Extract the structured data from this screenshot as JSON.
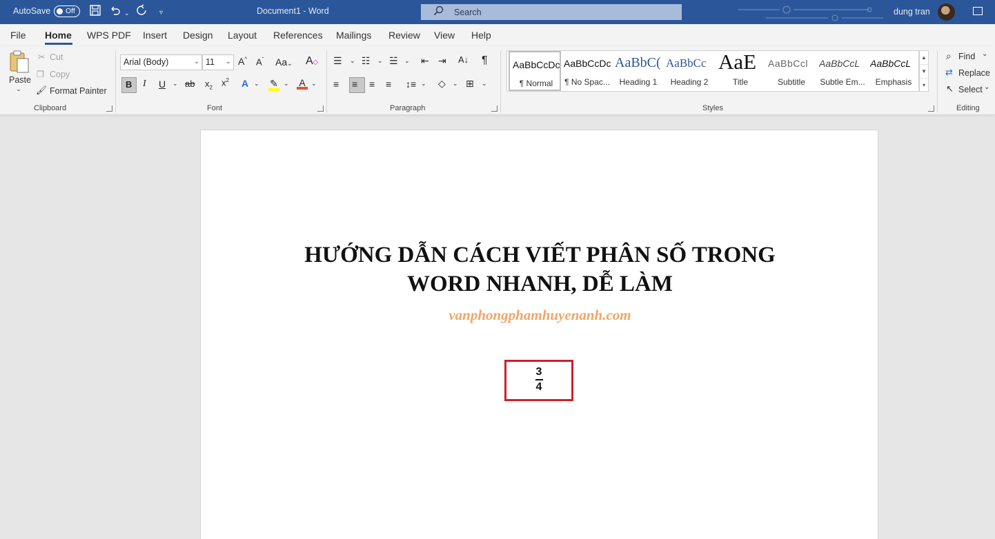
{
  "titlebar": {
    "autosave_label": "AutoSave",
    "autosave_state": "Off",
    "doc_title": "Document1  -  Word",
    "search_placeholder": "Search",
    "user_name": "dung tran",
    "bg_color": "#2b579a"
  },
  "tabs": [
    "File",
    "Home",
    "WPS PDF",
    "Insert",
    "Design",
    "Layout",
    "References",
    "Mailings",
    "Review",
    "View",
    "Help"
  ],
  "active_tab": "Home",
  "clipboard": {
    "paste": "Paste",
    "cut": "Cut",
    "copy": "Copy",
    "format_painter": "Format Painter",
    "label": "Clipboard"
  },
  "font": {
    "family": "Arial (Body)",
    "size": "11",
    "case": "Aa",
    "label": "Font"
  },
  "paragraph": {
    "label": "Paragraph"
  },
  "styles": {
    "label": "Styles",
    "items": [
      {
        "preview": "AaBbCcDc",
        "name": "¶ Normal"
      },
      {
        "preview": "AaBbCcDc",
        "name": "¶ No Spac..."
      },
      {
        "preview": "AaBbC(",
        "name": "Heading 1"
      },
      {
        "preview": "AaBbCc",
        "name": "Heading 2"
      },
      {
        "preview": "AaE",
        "name": "Title"
      },
      {
        "preview": "AaBbCcl",
        "name": "Subtitle"
      },
      {
        "preview": "AaBbCcL",
        "name": "Subtle Em..."
      },
      {
        "preview": "AaBbCcL",
        "name": "Emphasis"
      }
    ]
  },
  "editing": {
    "find": "Find",
    "replace": "Replace",
    "select": "Select",
    "label": "Editing"
  },
  "document": {
    "title_line1": "HƯỚNG DẪN CÁCH VIẾT PHÂN SỐ TRONG",
    "title_line2": "WORD NHANH, DỄ LÀM",
    "website": "vanphongphamhuyenanh.com",
    "numerator": "3",
    "denominator": "4",
    "highlight_color": "#cc1f2d",
    "website_color": "#f0a66a"
  }
}
